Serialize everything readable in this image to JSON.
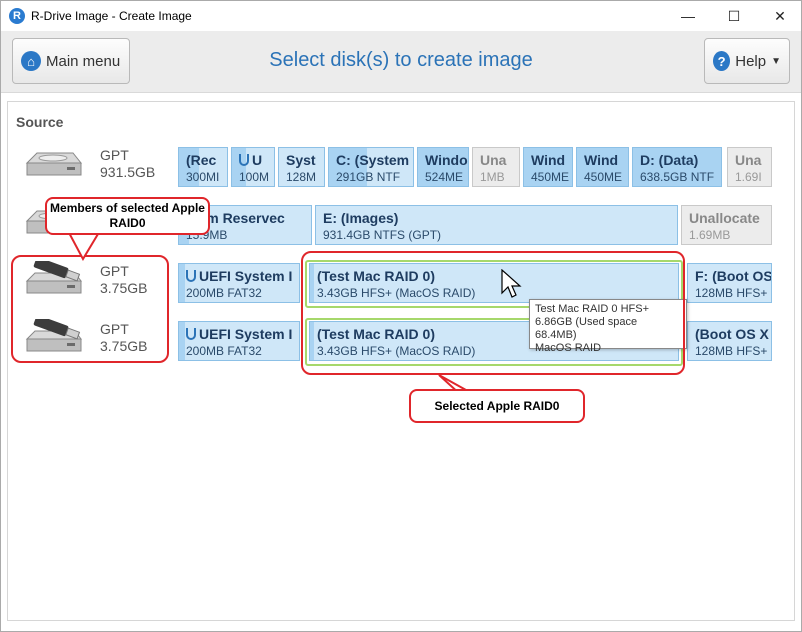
{
  "window": {
    "title": "R-Drive Image - Create Image",
    "app_icon_letter": "R"
  },
  "window_controls": {
    "minimize": "—",
    "maximize": "☐",
    "close": "✕"
  },
  "toolbar": {
    "main_menu_label": "Main menu",
    "page_title": "Select disk(s) to create image",
    "help_label": "Help"
  },
  "source_label": "Source",
  "disks": [
    {
      "type": "GPT",
      "size": "931.5GB",
      "partitions": [
        {
          "name": "(Rec",
          "info": "300MI"
        },
        {
          "name": "U",
          "info": "100M",
          "uefi": true
        },
        {
          "name": "Syst",
          "info": "128M"
        },
        {
          "name": "C: (System",
          "info": "291GB NTF"
        },
        {
          "name": "Windo",
          "info": "524ME"
        },
        {
          "name": "Una",
          "info": "1MB",
          "unalloc": true
        },
        {
          "name": "Wind",
          "info": "450ME"
        },
        {
          "name": "Wind",
          "info": "450ME"
        },
        {
          "name": "D: (Data)",
          "info": "638.5GB NTF"
        },
        {
          "name": "Una",
          "info": "1.69I",
          "unalloc": true
        }
      ]
    },
    {
      "type": "",
      "size": "",
      "partitions": [
        {
          "name": "stem Reservec",
          "info": "15.9MB"
        },
        {
          "name": "E: (Images)",
          "info": "931.4GB NTFS (GPT)"
        },
        {
          "name": "Unallocate",
          "info": "1.69MB",
          "unalloc": true
        }
      ]
    },
    {
      "type": "GPT",
      "size": "3.75GB",
      "partitions": [
        {
          "name": "UEFI System I",
          "info": "200MB FAT32",
          "uefi": true
        },
        {
          "name": "(Test Mac RAID 0)",
          "info": "3.43GB HFS+ (MacOS RAID)"
        },
        {
          "name": "F: (Boot OS",
          "info": "128MB HFS+"
        }
      ]
    },
    {
      "type": "GPT",
      "size": "3.75GB",
      "partitions": [
        {
          "name": "UEFI System I",
          "info": "200MB FAT32",
          "uefi": true
        },
        {
          "name": "(Test Mac RAID 0)",
          "info": "3.43GB HFS+ (MacOS RAID)"
        },
        {
          "name": "(Boot OS X",
          "info": "128MB HFS+"
        }
      ]
    }
  ],
  "tooltip": {
    "line1": "Test Mac RAID 0 HFS+",
    "line2": "6.86GB (Used space 68.4MB)",
    "line3": "MacOS RAID"
  },
  "annotations": {
    "members_label": "Members of selected Apple RAID0",
    "selected_label": "Selected Apple RAID0"
  },
  "colors": {
    "accent": "#2b73b7",
    "callout": "#e0262b",
    "partition": "#cfe7f8",
    "used_bar": "#a9d3f2"
  }
}
